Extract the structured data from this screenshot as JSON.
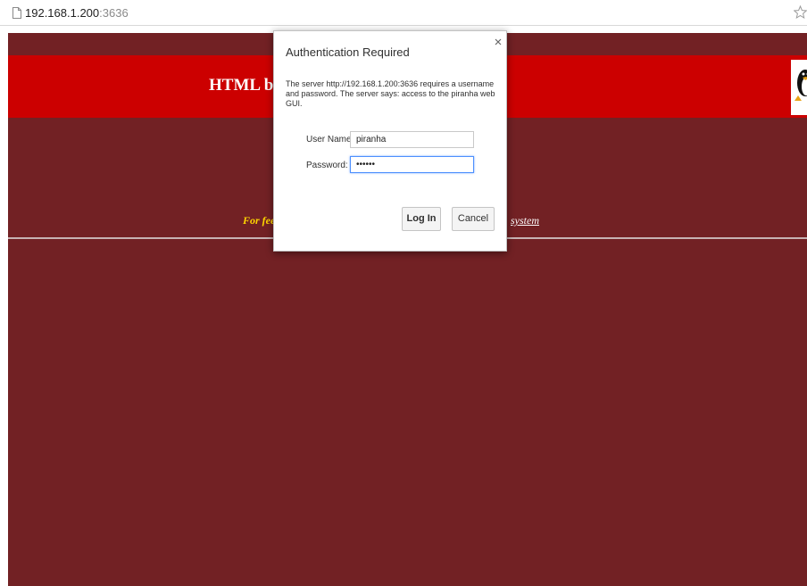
{
  "browser": {
    "url_host": "192.168.1.200",
    "url_port": ":3636",
    "page_icon": "page-icon",
    "bookmark_icon": "star-icon"
  },
  "page": {
    "banner_title": "HTML ba",
    "feedback_left": "For fee",
    "feedback_right": "system",
    "background_color": "#722124",
    "banner_color": "#cc0000",
    "logo": "penguin-logo"
  },
  "dialog": {
    "title": "Authentication Required",
    "close_icon": "close-icon",
    "message": "The server http://192.168.1.200:3636 requires a username and password. The server says: access to the piranha web GUI.",
    "username_label": "User Name:",
    "username_value": "piranha",
    "password_label": "Password:",
    "password_value": "••••••",
    "login_label": "Log In",
    "cancel_label": "Cancel"
  }
}
